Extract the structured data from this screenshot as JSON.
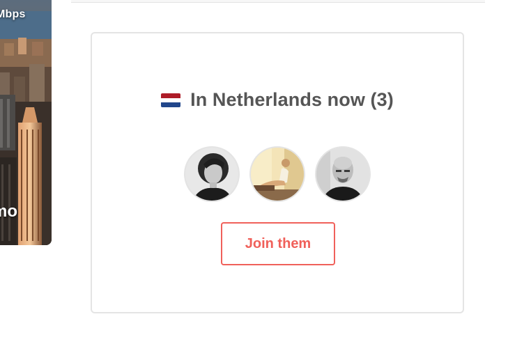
{
  "city_card": {
    "speed_text": "Mbps",
    "name_text": "mo"
  },
  "nomads_widget": {
    "flag": "netherlands-flag-icon",
    "heading": "In Netherlands now (3)",
    "avatars": [
      {
        "name": "nomad-avatar-1"
      },
      {
        "name": "nomad-avatar-2"
      },
      {
        "name": "nomad-avatar-3"
      }
    ],
    "join_label": "Join them"
  },
  "colors": {
    "accent": "#f0605a",
    "heading": "#555555",
    "border": "#e4e4e4"
  }
}
